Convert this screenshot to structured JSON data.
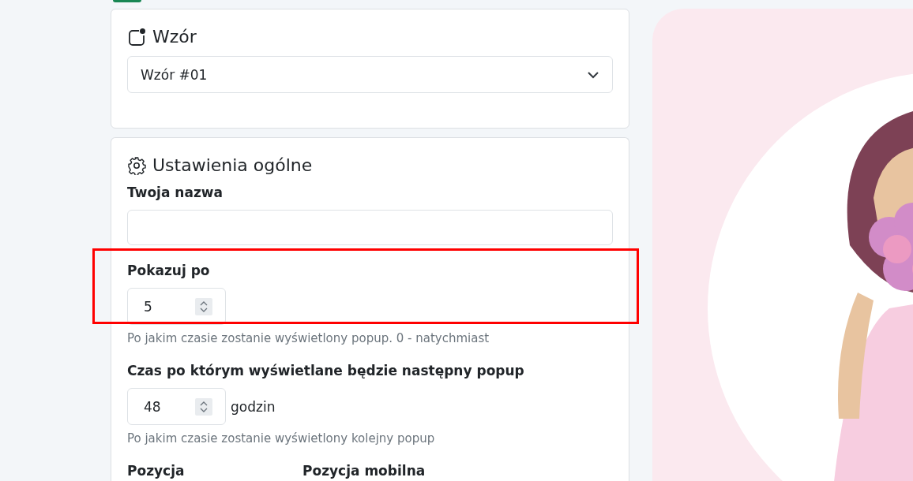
{
  "template_card": {
    "title": "Wzór",
    "select": {
      "value": "Wzór #01"
    }
  },
  "settings_card": {
    "title": "Ustawienia ogólne",
    "fields": [
      {
        "kind": "text",
        "label": "Twoja nazwa",
        "highlighted": false
      },
      {
        "kind": "number",
        "label": "Pokazuj po",
        "value": "5",
        "help": "Po jakim czasie zostanie wyświetlony popup. 0 - natychmiast",
        "highlighted": true
      },
      {
        "kind": "number",
        "label": "Czas po którym wyświetlane będzie następny popup",
        "value": "48",
        "unit": "godzin",
        "help": "Po jakim czasie zostanie wyświetlony kolejny popup",
        "highlighted": false
      }
    ],
    "columns": [
      "Pozycja",
      "Pozycja mobilna"
    ]
  }
}
